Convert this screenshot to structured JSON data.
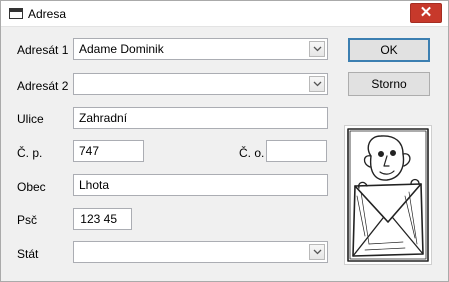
{
  "window": {
    "title": "Adresa",
    "close_label": "✕"
  },
  "form": {
    "adresat1": {
      "label": "Adresát 1",
      "value": "Adame Dominik"
    },
    "adresat2": {
      "label": "Adresát 2",
      "value": ""
    },
    "ulice": {
      "label": "Ulice",
      "value": "Zahradní"
    },
    "cp": {
      "label": "Č. p.",
      "value": "747"
    },
    "co": {
      "label": "Č. o.",
      "value": ""
    },
    "obec": {
      "label": "Obec",
      "value": "Lhota"
    },
    "psc": {
      "label": "Psč",
      "value": "123 45"
    },
    "stat": {
      "label": "Stát",
      "value": ""
    }
  },
  "buttons": {
    "ok_label": "OK",
    "cancel_label": "Storno"
  },
  "icons": {
    "app": "window-icon",
    "dropdown": "chevron-down-icon",
    "close": "close-icon",
    "picture": "envelope-sketch-image"
  }
}
